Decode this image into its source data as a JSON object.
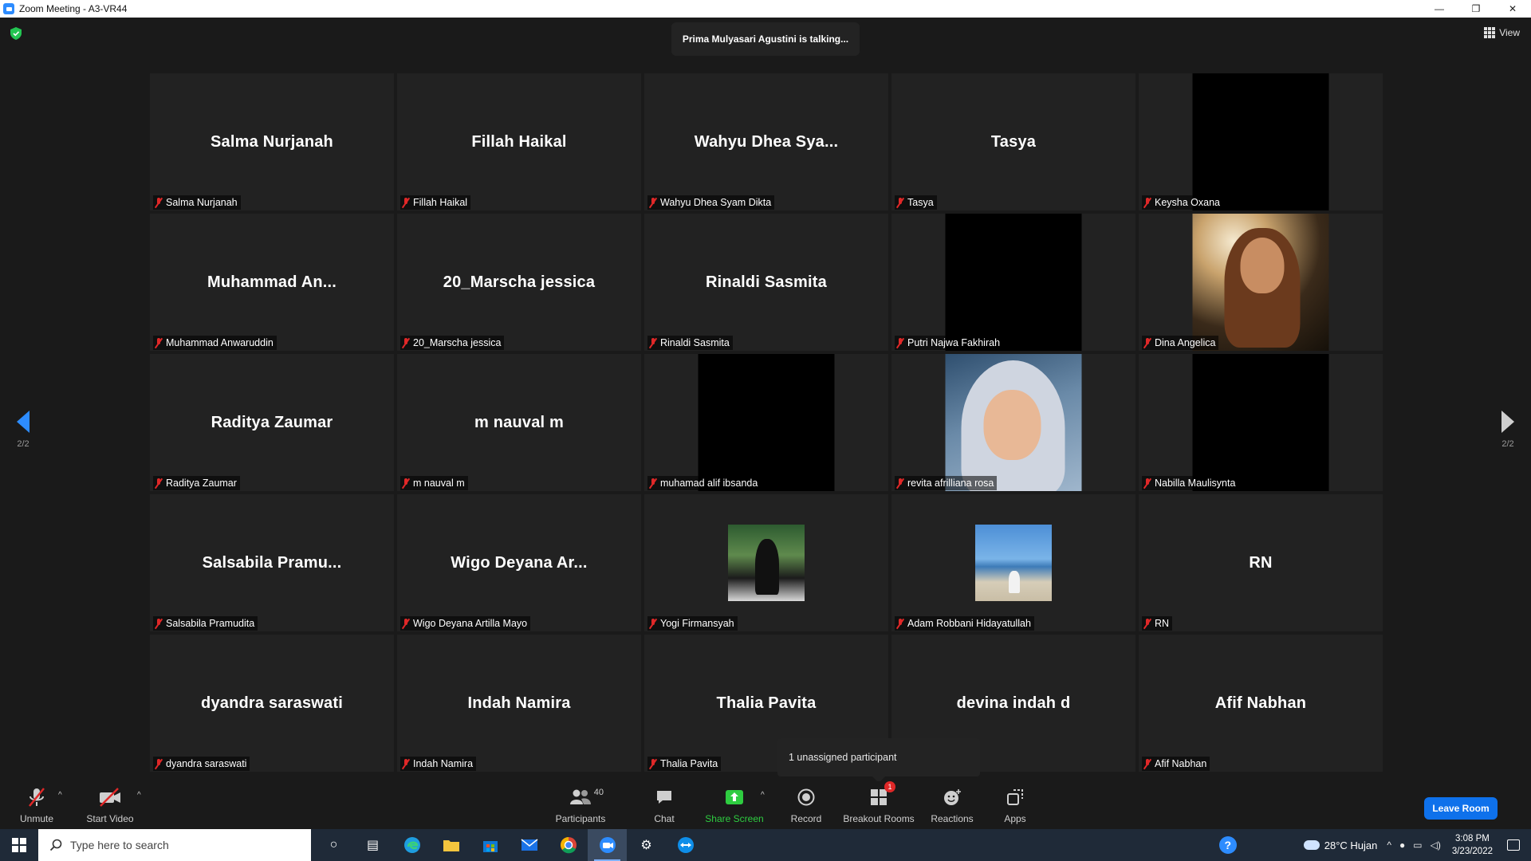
{
  "window": {
    "title": "Zoom Meeting - A3-VR44",
    "controls": {
      "minimize": "—",
      "restore": "❐",
      "close": "✕"
    }
  },
  "meeting": {
    "talking_banner": "Prima Mulyasari Agustini is talking...",
    "view_label": "View",
    "page_left": "2/2",
    "page_right": "2/2",
    "tooltip": "1 unassigned participant"
  },
  "tiles": [
    {
      "big": "Salma Nurjanah",
      "label": "Salma Nurjanah",
      "video": "none"
    },
    {
      "big": "Fillah Haikal",
      "label": "Fillah Haikal",
      "video": "none"
    },
    {
      "big": "Wahyu Dhea Sya...",
      "label": "Wahyu Dhea Syam Dikta",
      "video": "none"
    },
    {
      "big": "Tasya",
      "label": "Tasya",
      "video": "none"
    },
    {
      "big": "",
      "label": "Keysha Oxana",
      "video": "black"
    },
    {
      "big": "Muhammad An...",
      "label": "Muhammad Anwaruddin",
      "video": "none"
    },
    {
      "big": "20_Marscha jessica",
      "label": "20_Marscha jessica",
      "video": "none"
    },
    {
      "big": "Rinaldi Sasmita",
      "label": "Rinaldi Sasmita",
      "video": "none"
    },
    {
      "big": "",
      "label": "Putri Najwa Fakhirah",
      "video": "black"
    },
    {
      "big": "",
      "label": "Dina Angelica",
      "video": "portrait1"
    },
    {
      "big": "Raditya Zaumar",
      "label": "Raditya Zaumar",
      "video": "none"
    },
    {
      "big": "m nauval m",
      "label": "m nauval m",
      "video": "none"
    },
    {
      "big": "",
      "label": "muhamad alif ibsanda",
      "video": "black"
    },
    {
      "big": "",
      "label": "revita afrilliana rosa",
      "video": "portrait2"
    },
    {
      "big": "",
      "label": "Nabilla Maulisynta",
      "video": "black"
    },
    {
      "big": "Salsabila Pramu...",
      "label": "Salsabila Pramudita",
      "video": "none"
    },
    {
      "big": "Wigo Deyana Ar...",
      "label": "Wigo Deyana Artilla Mayo",
      "video": "none"
    },
    {
      "big": "",
      "label": "Yogi Firmansyah",
      "video": "photo-a"
    },
    {
      "big": "",
      "label": "Adam Robbani Hidayatullah",
      "video": "photo-b"
    },
    {
      "big": "RN",
      "label": "RN",
      "video": "none"
    },
    {
      "big": "dyandra saraswati",
      "label": "dyandra saraswati",
      "video": "none"
    },
    {
      "big": "Indah Namira",
      "label": "Indah Namira",
      "video": "none"
    },
    {
      "big": "Thalia Pavita",
      "label": "Thalia Pavita",
      "video": "none"
    },
    {
      "big": "devina indah d",
      "label": "",
      "video": "none"
    },
    {
      "big": "Afif Nabhan",
      "label": "Afif Nabhan",
      "video": "none"
    }
  ],
  "toolbar": {
    "unmute": "Unmute",
    "start_video": "Start Video",
    "participants": "Participants",
    "participants_count": "40",
    "chat": "Chat",
    "share_screen": "Share Screen",
    "record": "Record",
    "breakout_rooms": "Breakout Rooms",
    "breakout_badge": "1",
    "reactions": "Reactions",
    "apps": "Apps",
    "leave": "Leave Room"
  },
  "taskbar": {
    "search_placeholder": "Type here to search",
    "weather": "28°C  Hujan",
    "time": "3:08 PM",
    "date": "3/23/2022"
  },
  "colors": {
    "accent": "#2d8cff",
    "leave": "#0e71eb",
    "share_green": "#2ecc40",
    "muted_red": "#e02828",
    "stage_bg": "#1a1a1a",
    "tile_bg": "#222222"
  }
}
